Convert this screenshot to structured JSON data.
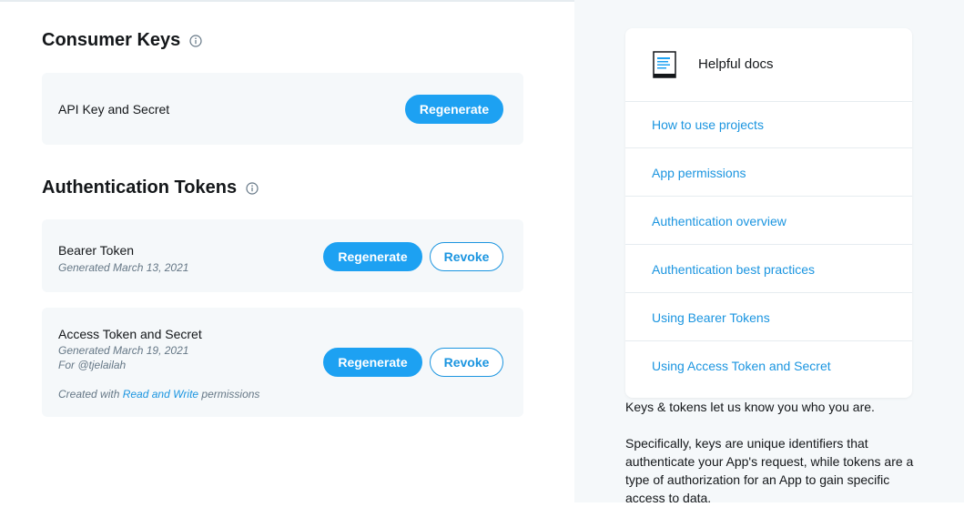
{
  "consumer_keys": {
    "title": "Consumer Keys",
    "api_key": {
      "label": "API Key and Secret",
      "regenerate": "Regenerate"
    }
  },
  "auth_tokens": {
    "title": "Authentication Tokens",
    "bearer": {
      "label": "Bearer Token",
      "generated": "Generated March 13, 2021",
      "regenerate": "Regenerate",
      "revoke": "Revoke"
    },
    "access": {
      "label": "Access Token and Secret",
      "generated": "Generated March 19, 2021",
      "for_user": "For @tjelailah",
      "created_prefix": "Created with ",
      "permission_link": "Read and Write",
      "created_suffix": " permissions",
      "regenerate": "Regenerate",
      "revoke": "Revoke"
    }
  },
  "helpful_docs": {
    "title": "Helpful docs",
    "links": [
      "How to use projects",
      "App permissions",
      "Authentication overview",
      "Authentication best practices",
      "Using Bearer Tokens",
      "Using Access Token and Secret"
    ]
  },
  "side_text": {
    "p1": "Keys & tokens let us know you who you are.",
    "p2": "Specifically, keys are unique identifiers that authenticate your App's request, while tokens are a type of authorization for an App to gain specific access to data."
  },
  "colors": {
    "accent": "#1da1f2",
    "link": "#1b95e0",
    "panel": "#f5f8fa"
  }
}
